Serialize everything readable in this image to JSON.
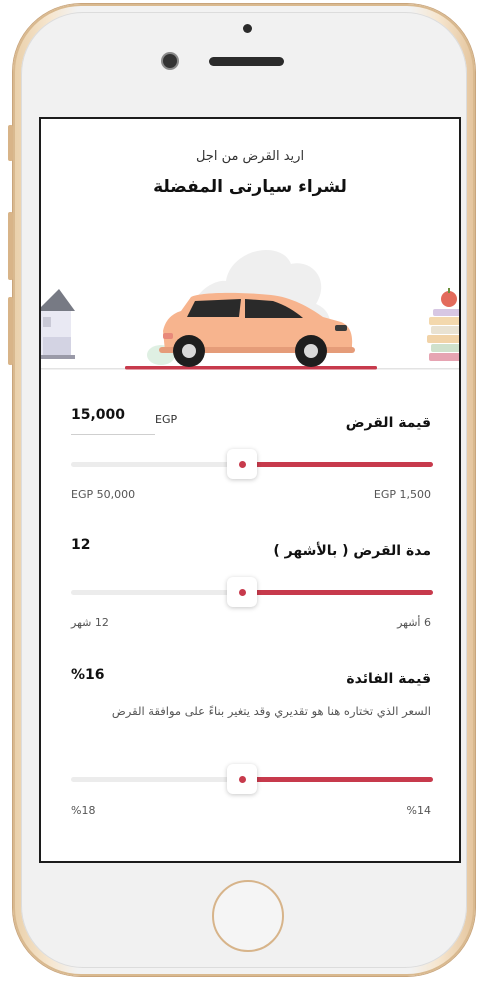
{
  "header": {
    "subtitle": "اريد القرض من اجل",
    "title": "لشراء سيارتى المفضلة"
  },
  "loan_amount": {
    "label": "قيمة القرض",
    "value": "15,000",
    "currency": "EGP",
    "min_label": "EGP 1,500",
    "max_label": "EGP 50,000",
    "level": 0.45
  },
  "loan_term": {
    "label": "مدة القرض ( بالأشهر )",
    "value": "12",
    "min_label": "6 أشهر",
    "max_label": "12 شهر",
    "level": 0.45
  },
  "interest": {
    "label": "قيمة الفائدة",
    "value": "%16",
    "note": "السعر الذي تختاره هنا هو تقديري وقد يتغير بناءً على موافقة القرض",
    "min_label": "%14",
    "max_label": "%18",
    "level": 0.45
  },
  "colors": {
    "accent": "#c73a4c",
    "car_body": "#f7b48e",
    "track": "#ececec"
  },
  "icons": [
    "car-illustration",
    "house-illustration",
    "books-illustration"
  ]
}
